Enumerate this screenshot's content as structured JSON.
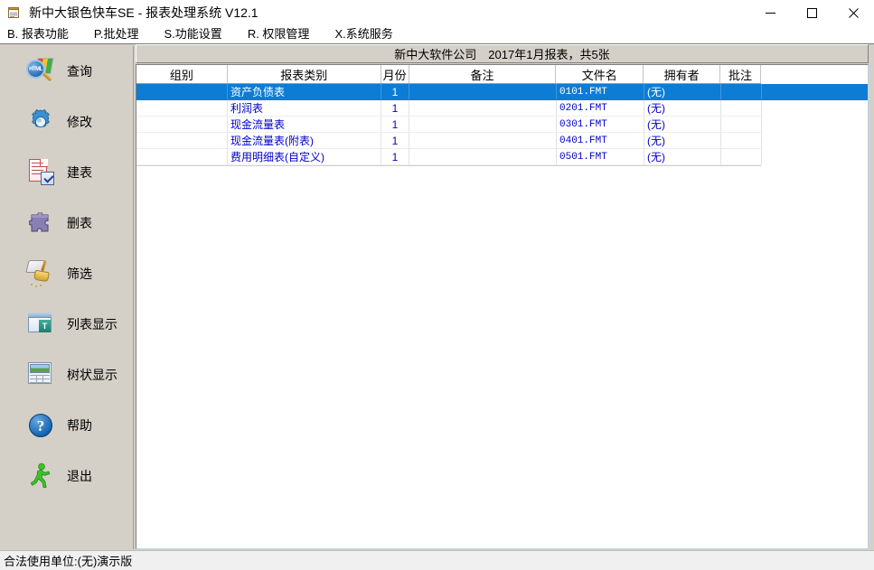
{
  "window": {
    "icon": "notepad-icon",
    "title": "新中大银色快车SE - 报表处理系统 V12.1",
    "minimize_label": "—",
    "maximize_label": "□",
    "close_label": "✕"
  },
  "menubar": {
    "items": [
      {
        "label": "B. 报表功能"
      },
      {
        "label": "P.批处理"
      },
      {
        "label": "S.功能设置"
      },
      {
        "label": "R. 权限管理"
      },
      {
        "label": "X.系统服务"
      }
    ]
  },
  "caption": {
    "text": "新中大软件公司　2017年1月报表，共5张"
  },
  "sidebar": {
    "items": [
      {
        "label": "查询",
        "icon": "html-search-icon"
      },
      {
        "label": "修改",
        "icon": "gear-icon"
      },
      {
        "label": "建表",
        "icon": "document-check-icon"
      },
      {
        "label": "删表",
        "icon": "puzzle-delete-icon"
      },
      {
        "label": "筛选",
        "icon": "broom-filter-icon"
      },
      {
        "label": "列表显示",
        "icon": "list-view-icon"
      },
      {
        "label": "树状显示",
        "icon": "tree-view-icon"
      },
      {
        "label": "帮助",
        "icon": "help-question-icon"
      },
      {
        "label": "退出",
        "icon": "exit-runner-icon"
      }
    ]
  },
  "grid": {
    "columns": [
      {
        "key": "group",
        "label": "组别"
      },
      {
        "key": "type",
        "label": "报表类别"
      },
      {
        "key": "month",
        "label": "月份"
      },
      {
        "key": "memo",
        "label": "备注"
      },
      {
        "key": "file",
        "label": "文件名"
      },
      {
        "key": "owner",
        "label": "拥有者"
      },
      {
        "key": "note",
        "label": "批注"
      }
    ],
    "rows": [
      {
        "group": "",
        "type": "资产负债表",
        "month": "1",
        "memo": "",
        "file": "0101.FMT",
        "owner": "(无)",
        "note": "",
        "selected": true
      },
      {
        "group": "",
        "type": "利润表",
        "month": "1",
        "memo": "",
        "file": "0201.FMT",
        "owner": "(无)",
        "note": "",
        "selected": false
      },
      {
        "group": "",
        "type": "现金流量表",
        "month": "1",
        "memo": "",
        "file": "0301.FMT",
        "owner": "(无)",
        "note": "",
        "selected": false
      },
      {
        "group": "",
        "type": "现金流量表(附表)",
        "month": "1",
        "memo": "",
        "file": "0401.FMT",
        "owner": "(无)",
        "note": "",
        "selected": false
      },
      {
        "group": "",
        "type": "费用明细表(自定义)",
        "month": "1",
        "memo": "",
        "file": "0501.FMT",
        "owner": "(无)",
        "note": "",
        "selected": false
      }
    ]
  },
  "statusbar": {
    "text": "合法使用单位:(无)演示版"
  },
  "colors": {
    "selection_blue": "#0c7cd5",
    "cell_text_blue": "#0000cc",
    "panel_gray": "#d4d0c8",
    "status_gray": "#f0f0f0"
  }
}
